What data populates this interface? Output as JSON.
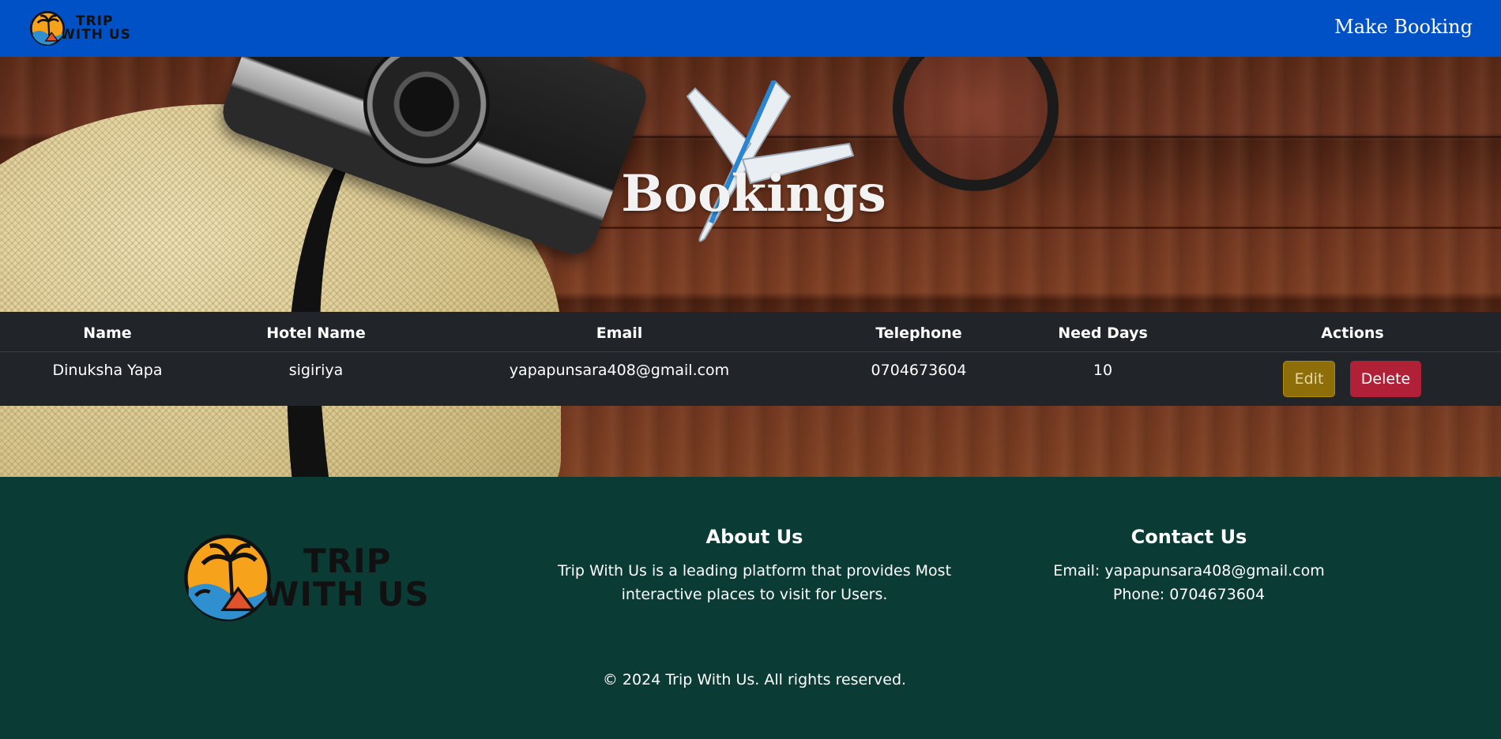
{
  "navbar": {
    "logo_line1": "TRIP",
    "logo_line2": "WITH US",
    "make_booking": "Make Booking",
    "brand_color": "#0051c5"
  },
  "hero": {
    "title": "Bookings"
  },
  "table": {
    "headers": [
      "Name",
      "Hotel Name",
      "Email",
      "Telephone",
      "Need Days",
      "Actions"
    ],
    "rows": [
      {
        "name": "Dinuksha Yapa",
        "hotel_name": "sigiriya",
        "email": "yapapunsara408@gmail.com",
        "telephone": "0704673604",
        "need_days": "10",
        "edit_label": "Edit",
        "delete_label": "Delete"
      }
    ]
  },
  "footer": {
    "logo_line1": "TRIP",
    "logo_line2": "WITH US",
    "about_title": "About Us",
    "about_line1": "Trip With Us is a leading platform that provides Most",
    "about_line2": "interactive places to visit for Users.",
    "contact_title": "Contact Us",
    "contact_email": "Email: yapapunsara408@gmail.com",
    "contact_phone": "Phone: 0704673604",
    "copyright": "© 2024 Trip With Us. All rights reserved.",
    "background_color": "#0b3b35"
  },
  "icons": {
    "logo_icon": "sunset-palm-tree-circle-icon",
    "plane_icon": "airplane-icon"
  }
}
